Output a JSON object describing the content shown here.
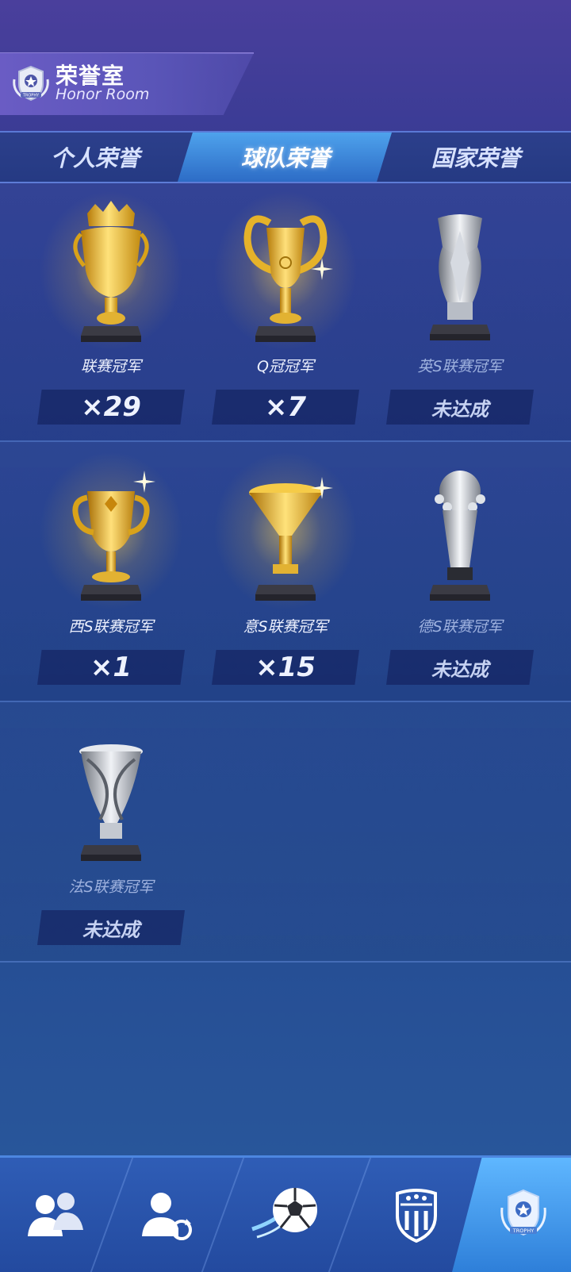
{
  "header": {
    "title_cn": "荣誉室",
    "title_en": "Honor Room",
    "emblem_text": "TROPHY"
  },
  "tabs": [
    {
      "label": "个人荣誉",
      "active": false
    },
    {
      "label": "球队荣誉",
      "active": true
    },
    {
      "label": "国家荣誉",
      "active": false
    }
  ],
  "trophies": [
    {
      "name": "联赛冠军",
      "count": "×29",
      "achieved": true,
      "style": "gold-crown"
    },
    {
      "name": "Q冠冠军",
      "count": "×7",
      "achieved": true,
      "style": "gold-bigears"
    },
    {
      "name": "英S联赛冠军",
      "count": "未达成",
      "achieved": false,
      "style": "silver-winged"
    },
    {
      "name": "西S联赛冠军",
      "count": "×1",
      "achieved": true,
      "style": "gold-cup"
    },
    {
      "name": "意S联赛冠军",
      "count": "×15",
      "achieved": true,
      "style": "gold-funnel"
    },
    {
      "name": "德S联赛冠军",
      "count": "未达成",
      "achieved": false,
      "style": "silver-ball"
    },
    {
      "name": "法S联赛冠军",
      "count": "未达成",
      "achieved": false,
      "style": "silver-twist"
    }
  ],
  "bottom_nav": [
    {
      "icon": "team-players-icon",
      "active": false
    },
    {
      "icon": "player-swap-icon",
      "active": false
    },
    {
      "icon": "soccer-ball-icon",
      "active": false
    },
    {
      "icon": "club-badge-icon",
      "active": false
    },
    {
      "icon": "trophy-badge-icon",
      "active": true,
      "text": "TROPHY"
    }
  ],
  "colors": {
    "gold": "#f2c230",
    "silver": "#c9cfd8",
    "active_tab": "#3f8fe2"
  }
}
